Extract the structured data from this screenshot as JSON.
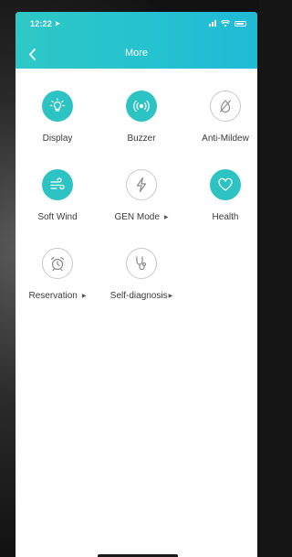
{
  "status_bar": {
    "time": "12:22"
  },
  "header": {
    "title": "More"
  },
  "tiles": [
    {
      "label": "Display",
      "icon": "bulb-icon",
      "state": "on"
    },
    {
      "label": "Buzzer",
      "icon": "buzzer-icon",
      "state": "on"
    },
    {
      "label": "Anti-Mildew",
      "icon": "anti-mildew-icon",
      "state": "off"
    },
    {
      "label": "Soft Wind",
      "icon": "wind-icon",
      "state": "on"
    },
    {
      "label": "GEN Mode",
      "icon": "lightning-icon",
      "state": "off",
      "has_submenu": true
    },
    {
      "label": "Health",
      "icon": "heart-icon",
      "state": "on"
    },
    {
      "label": "Reservation",
      "icon": "alarm-clock-icon",
      "state": "off",
      "has_submenu": true
    },
    {
      "label": "Self-diagnosis",
      "icon": "stethoscope-icon",
      "state": "off",
      "has_submenu": true
    }
  ],
  "colors": {
    "accent": "#2ec3c3",
    "header": "#25c2d0",
    "inactive_border": "#c8c8c8"
  }
}
